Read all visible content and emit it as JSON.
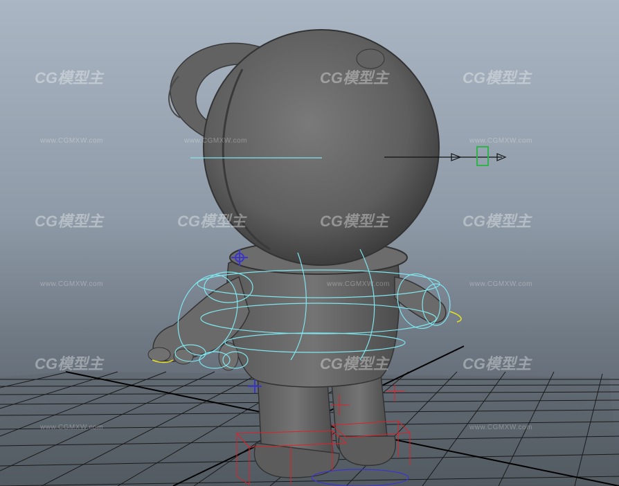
{
  "viewport": {
    "background_top": "#aab6c3",
    "background_bottom": "#50575f",
    "grid_color": "#111111",
    "model_color": "#6a6a6a",
    "nurbs_curve_color": "#7fe6ee",
    "selected_control_color": "#2fb34a",
    "bound_box_color": "#e0202a",
    "locator_color": "#3a37c8",
    "highlight_curve_color": "#e8e020"
  },
  "watermark": {
    "logo_text": "CG模型主",
    "url_text": "www.CGMXW.com"
  },
  "icons": {
    "grid": "perspective-grid-icon",
    "character": "astronaut-model-icon",
    "manipulator": "translate-arrow-icon"
  }
}
